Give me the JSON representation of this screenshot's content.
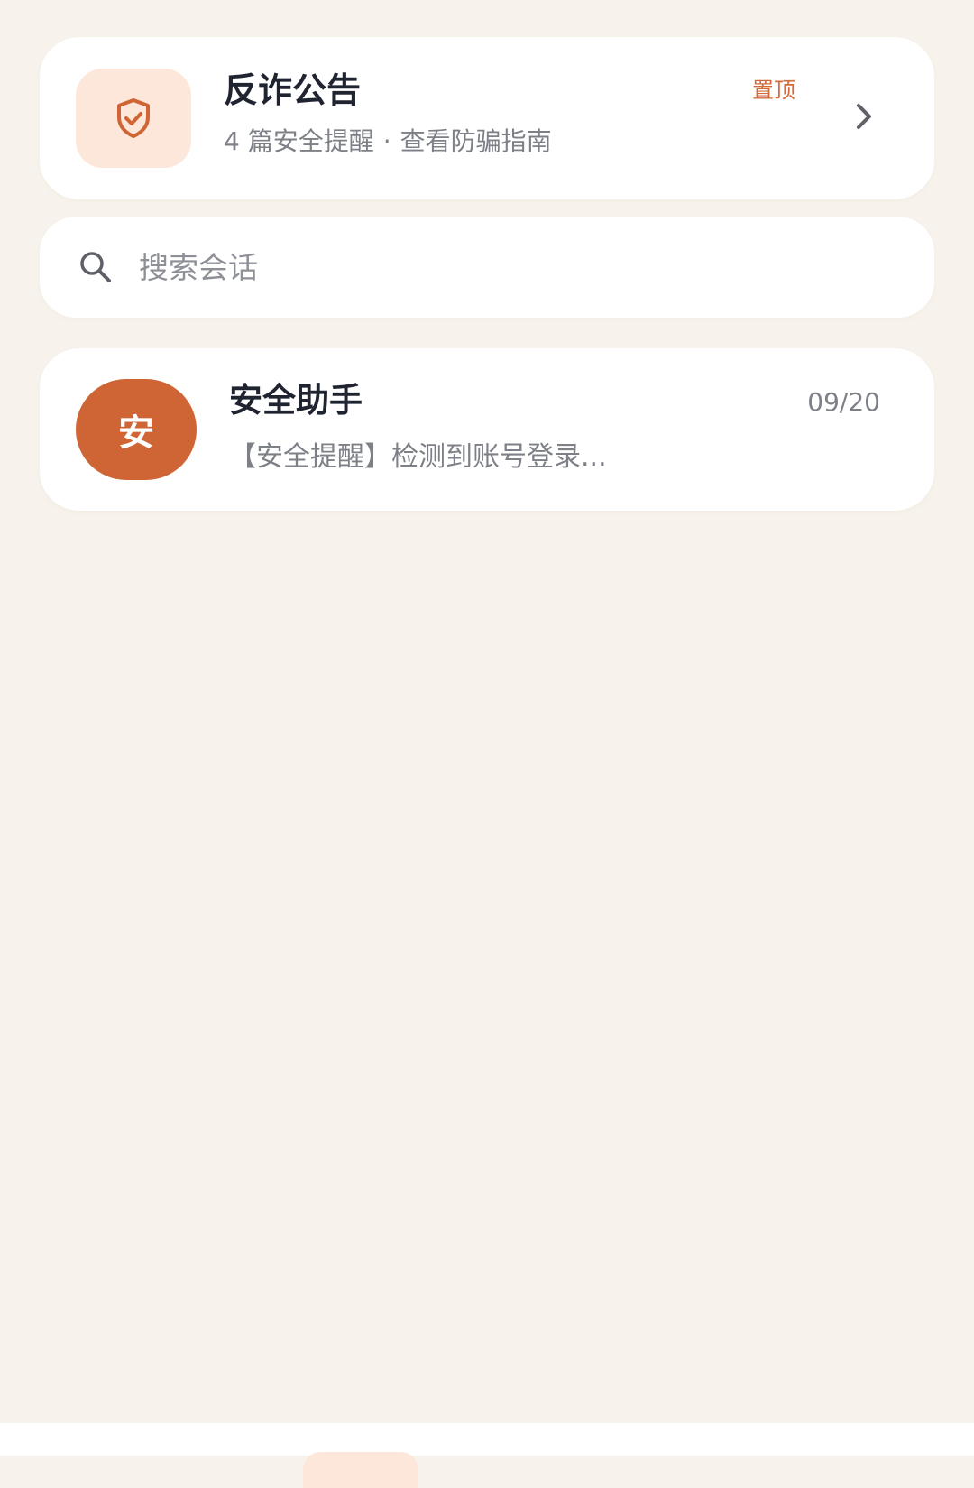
{
  "announcement": {
    "title": "反诈公告",
    "subtitle_count": "4 篇安全提醒",
    "subtitle_separator": "·",
    "subtitle_link": "查看防骗指南",
    "pin_label": "置顶",
    "icon": "shield-check-icon",
    "chevron_icon": "chevron-right-icon"
  },
  "search": {
    "placeholder": "搜索会话",
    "value": "",
    "icon": "search-icon"
  },
  "conversations": [
    {
      "avatar_text": "安",
      "name": "安全助手",
      "time": "09/20",
      "preview": "【安全提醒】检测到账号登录..."
    }
  ],
  "colors": {
    "background": "#f7f3ec",
    "card": "#ffffff",
    "accent": "#cf6535",
    "accent_light": "#fde6da",
    "pin_text": "#d36a3c",
    "title_text": "#1f2430",
    "secondary_text": "#7d8087"
  }
}
